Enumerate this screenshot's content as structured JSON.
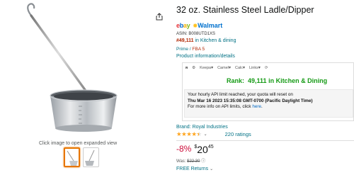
{
  "product": {
    "title": "32 oz. Stainless Steel Ladle/Dipper",
    "asin": "ASIN: B008UTD1XS",
    "rank_number": "#49,111",
    "rank_category": "in Kitchen & dining",
    "prime": "Prime /",
    "fba": "FBA 5",
    "product_info_link": "Product information/details",
    "brand": "Brand: Royal Industries",
    "ratings_count": "220 ratings",
    "star_rating": 4.5,
    "discount": "-8%",
    "price_symbol": "$",
    "price_whole": "20",
    "price_fraction": "45",
    "was_label": "Was:",
    "was_price": "$22.30",
    "returns": "FREE Returns",
    "returns_chevron": "⌄"
  },
  "marketplaces": {
    "ebay": {
      "e": "e",
      "b": "b",
      "a": "a",
      "y": "y"
    },
    "walmart": "Walmart"
  },
  "keepa": {
    "tabs": [
      "Keepa",
      "Camel",
      "Calc",
      "Links"
    ],
    "rank_label": "Rank:",
    "rank_value": "49,111 in Kitchen & Dining",
    "msg_line1": "Your hourly API limit reached, your quota will reset on",
    "msg_line2": "Thu Mar 16 2023 15:35:08 GMT-0700 (Pacific Daylight Time)",
    "msg_line3_prefix": "For more info on API limits, click",
    "msg_link": "here"
  },
  "image_panel": {
    "caption": "Click image to open expanded view"
  },
  "colors": {
    "accent_orange": "#e77600",
    "link": "#007185",
    "price_red": "#b12704",
    "keepa_green": "#149a14",
    "discount_red": "#cc0c39",
    "star": "#ffa41c"
  }
}
